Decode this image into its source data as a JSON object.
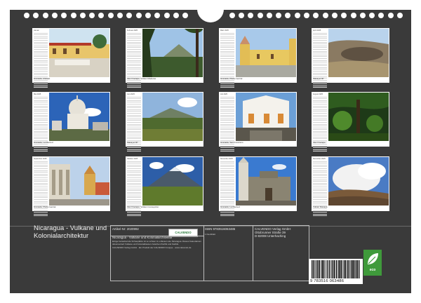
{
  "cover": {
    "title": "Nicaragua - Vulkane und Kolonialarchitektur"
  },
  "months": [
    {
      "name": "Januar",
      "caption": "Granada, Altstadt",
      "scene": "colonial-street"
    },
    {
      "name": "Februar 2025",
      "caption": "Isla Ometepe, Vulkan Maderas",
      "scene": "volcano-trees"
    },
    {
      "name": "März 2025",
      "caption": "Granada, Plaza Central",
      "scene": "yellow-church"
    },
    {
      "name": "April 2025",
      "caption": "Masaya NP",
      "scene": "crater"
    },
    {
      "name": "Mai 2025",
      "caption": "Granada, La Merced",
      "scene": "dome-church"
    },
    {
      "name": "Juni 2025",
      "caption": "Masaya NP",
      "scene": "plain-volcano"
    },
    {
      "name": "Juli 2025",
      "caption": "Granada, San Francisco",
      "scene": "white-church"
    },
    {
      "name": "August 2025",
      "caption": "Isla Ometepe",
      "scene": "jungle"
    },
    {
      "name": "September 2025",
      "caption": "Granada, Plaza Central",
      "scene": "arcade"
    },
    {
      "name": "Oktober 2025",
      "caption": "Isla Ometepe, Vulkan Concepción",
      "scene": "cone-volcano"
    },
    {
      "name": "November 2025",
      "caption": "Granada, La Merced",
      "scene": "baroque-church"
    },
    {
      "name": "Dezember 2025",
      "caption": "Vulkan Masaya",
      "scene": "smoke-volcano"
    }
  ],
  "info": {
    "article": "Artikel-Nr: 2020992",
    "logo_text": "CALVENDO",
    "product_title": "Nicaragua - Vulkane und Kolonialarchitektur",
    "description": "Einige bezaubernde Schauplätze ist so schwer zu erfassen wie Nicaragua. Dieses Kalendarium dokumentiert Vulkane und Kolonialbauten zwischen Pazifik und Karibik.",
    "publisher_note": "CALVENDO Verlag GmbH · Ein Produkt der CALVENDO Gruppe · www.calvendo.de",
    "isbn": "ISBN 9783516063486",
    "format_note": "1 Deckblatt",
    "address": [
      "CALVENDO Verlag GmbH",
      "Ottobrunner Straße 39",
      "D-82008 Unterhaching"
    ],
    "barcode_number": "9 783516 063486",
    "eco_label": "eco"
  }
}
